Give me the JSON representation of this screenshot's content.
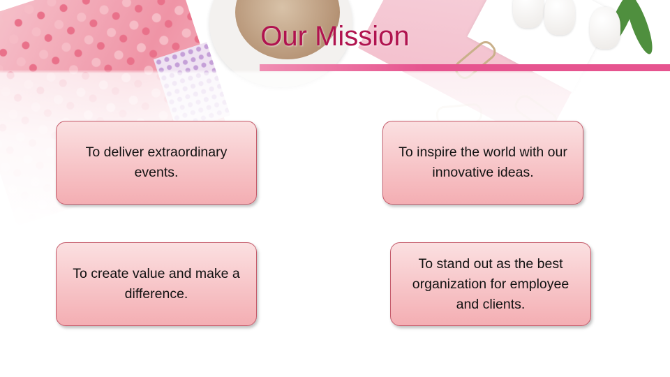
{
  "slide": {
    "title": "Our Mission",
    "boxes": [
      {
        "text": "To deliver extraordinary events."
      },
      {
        "text": "To inspire the world with our innovative ideas."
      },
      {
        "text": "To create value and make a difference."
      },
      {
        "text": "To stand out as the best organization for employee and clients."
      }
    ]
  },
  "colors": {
    "title": "#b0134f",
    "accent_bar": "#e6548f",
    "box_fill_top": "#fbe0e1",
    "box_fill_bottom": "#f4aeb3",
    "box_border": "#c45a6a"
  }
}
